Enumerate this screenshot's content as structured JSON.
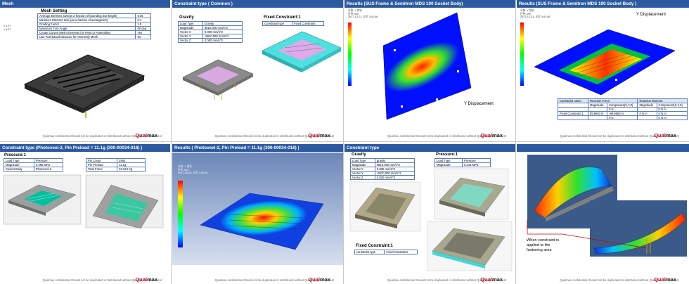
{
  "slides": {
    "s1": {
      "title": "Mesh",
      "table_title": "Mesh Setting",
      "rows": [
        [
          "Average Element Size(as a fraction of bounding box lenght)",
          "0.05"
        ],
        [
          "Minimum Element Size (as a fraction of averagesize)",
          "0.1"
        ],
        [
          "Grading Factor",
          "1.5"
        ],
        [
          "Maximum Turn Angle",
          "60 deg"
        ],
        [
          "Create Curved Mesh Elements for Parts or Assemblies",
          "Yes"
        ],
        [
          "Use Part-based Measure for Assembly Mesh",
          "No"
        ]
      ]
    },
    "s2": {
      "title": "Constraint type ( Common )",
      "gravity_title": "Gravity",
      "gravity_rows": [
        [
          "Load Type",
          "Gravity"
        ],
        [
          "Magnitude",
          "9810.000 mm/s^2"
        ],
        [
          "Vector X",
          "0.000 mm/s^2"
        ],
        [
          "Vector Y",
          "-9810.000 mm/s^2"
        ],
        [
          "Vector Z",
          "0.000 mm/s^2"
        ]
      ],
      "fixed_title": "Fixed Constraint:1",
      "fixed_rows": [
        [
          "Constraint type",
          "Fixed Constraint"
        ]
      ]
    },
    "s3": {
      "title": "Results (SUS Frame & Semitron MDS 100 Socket Body)",
      "annotation": "Y Displacement",
      "legend_text": "유형: Y 변위\n단위: mm\n2017-12-21, 오후 3:41:06"
    },
    "s4": {
      "title": "Results (SUS Frame & Semitron MDS 100 Socket Body )",
      "annotation": "Y Displacement",
      "legend_text": "유형: Y 변위\n단위: mm\n2017-12-21, 오후 3:41:06",
      "reaction_header": [
        "Constraint name",
        "Reaction Force",
        "",
        "Reaction Moment",
        ""
      ],
      "reaction_sub": [
        "",
        "Magnitude",
        "Component(X,Y,Z)",
        "Magnitude",
        "Component(X,Y,Z)"
      ],
      "reaction_rows": [
        [
          "",
          "",
          "0 N",
          "",
          "0 N m"
        ],
        [
          "Fixed Constraint:1",
          "89.9663 N",
          "-89.9663 N",
          "0 N m",
          "0 N m"
        ],
        [
          "",
          "",
          "0 N",
          "",
          "0 N m"
        ]
      ]
    },
    "s5": {
      "title": "Constraint type (Photoveel-2, Pin Preload = 11.1g (300-00034-018) )",
      "pressure_title": "Pressure:1",
      "pressure_rows": [
        [
          "Load Type",
          "Pressure"
        ],
        [
          "Magnitude",
          "0.485 MPa"
        ],
        [
          "Socket Body",
          "Photoveel-2"
        ]
      ],
      "pin_rows": [
        [
          "Pin Count",
          "2904"
        ],
        [
          "Pin Preload",
          "11.1g"
        ],
        [
          "Total Force",
          "32.234 Kg"
        ]
      ]
    },
    "s6": {
      "title": "Results ( Photoveel-2, Pin Preload = 11.1g (300-00034-018) )",
      "legend_text": "유형: Y 변위\n단위: mm\n2017-09-05, 오후 1:52:25"
    },
    "s7": {
      "title": "Constraint type",
      "gravity_title": "Gravity",
      "gravity_rows": [
        [
          "Load Type",
          "gravity"
        ],
        [
          "Magnitude",
          "9810.000 mm/s^2"
        ],
        [
          "Vector X",
          "0.000 mm/s^2"
        ],
        [
          "Vector Y",
          "-9810.000 mm/s^2"
        ],
        [
          "Vector Z",
          "0.000 mm/s^2"
        ]
      ],
      "pressure_title": "Pressure:1",
      "pressure_rows": [
        [
          "Load Type",
          "Pressure"
        ],
        [
          "Magnitude",
          "0.144 MPa"
        ]
      ],
      "fixed_title": "Fixed Constraint:1",
      "fixed_rows": [
        [
          "constraint type",
          "Fixed Constraint"
        ]
      ]
    },
    "s8": {
      "title": "",
      "annotation": "When constraint is\napplied to the\nfastening area"
    }
  },
  "footer": {
    "text": "Qualmax  confidential   Should not be duplicated or distributed without Qualmax prior consent",
    "logo_a": "Qual",
    "logo_b": "max"
  },
  "colors": {
    "header": "#2c5aa0",
    "brand": "#c8102e"
  }
}
